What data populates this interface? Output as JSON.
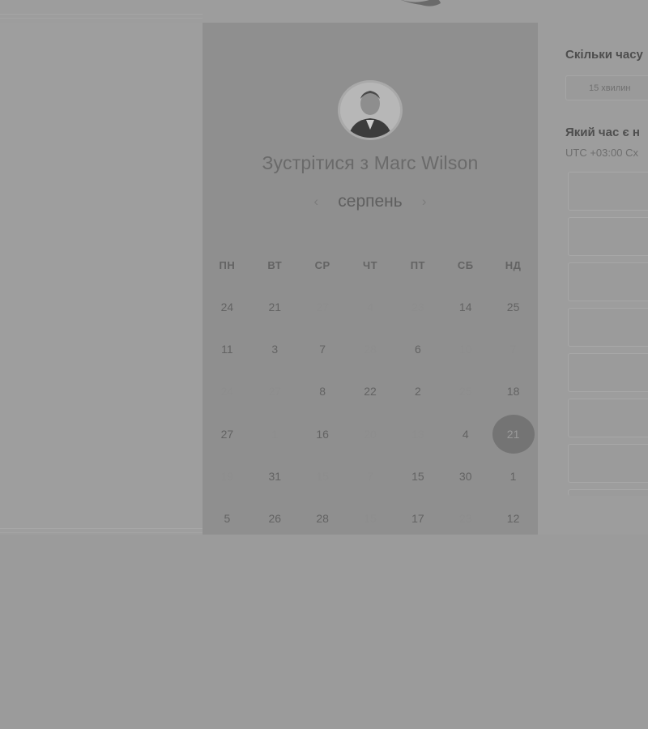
{
  "scheduler": {
    "title": "Зустрітися з Marc Wilson",
    "month": "серпень",
    "prev_icon": "chevron-left-icon",
    "next_icon": "chevron-right-icon",
    "weekdays": [
      "ПН",
      "ВТ",
      "СР",
      "ЧТ",
      "ПТ",
      "СБ",
      "НД"
    ],
    "days": [
      {
        "label": "24",
        "dim": false
      },
      {
        "label": "21",
        "dim": false
      },
      {
        "label": "27",
        "dim": true
      },
      {
        "label": "4",
        "dim": true
      },
      {
        "label": "23",
        "dim": true
      },
      {
        "label": "14",
        "dim": false
      },
      {
        "label": "25",
        "dim": false
      },
      {
        "label": "11",
        "dim": false
      },
      {
        "label": "3",
        "dim": false
      },
      {
        "label": "7",
        "dim": false
      },
      {
        "label": "28",
        "dim": true
      },
      {
        "label": "6",
        "dim": false
      },
      {
        "label": "10",
        "dim": true
      },
      {
        "label": "7",
        "dim": true
      },
      {
        "label": "24",
        "dim": true
      },
      {
        "label": "27",
        "dim": true
      },
      {
        "label": "8",
        "dim": false
      },
      {
        "label": "22",
        "dim": false
      },
      {
        "label": "2",
        "dim": false
      },
      {
        "label": "25",
        "dim": true
      },
      {
        "label": "18",
        "dim": false
      },
      {
        "label": "27",
        "dim": false
      },
      {
        "label": "1",
        "dim": true
      },
      {
        "label": "16",
        "dim": false
      },
      {
        "label": "20",
        "dim": true
      },
      {
        "label": "13",
        "dim": true
      },
      {
        "label": "4",
        "dim": false
      },
      {
        "label": "21",
        "dim": false,
        "selected": true
      },
      {
        "label": "19",
        "dim": true
      },
      {
        "label": "31",
        "dim": false
      },
      {
        "label": "15",
        "dim": true
      },
      {
        "label": "7",
        "dim": true
      },
      {
        "label": "15",
        "dim": false
      },
      {
        "label": "30",
        "dim": false
      },
      {
        "label": "1",
        "dim": false
      },
      {
        "label": "5",
        "dim": false
      },
      {
        "label": "26",
        "dim": false
      },
      {
        "label": "28",
        "dim": false
      },
      {
        "label": "15",
        "dim": true
      },
      {
        "label": "17",
        "dim": false
      },
      {
        "label": "23",
        "dim": true
      },
      {
        "label": "12",
        "dim": false
      }
    ]
  },
  "booking": {
    "duration_question": "Скільки часу",
    "duration_value": "15 хвилин",
    "time_question": "Який час є н",
    "timezone": "UTC +03:00 Сх"
  },
  "colors": {
    "overlay": "#9b9b9b",
    "calendar_panel": "#8f8f8f",
    "selected_day": "#747474"
  }
}
